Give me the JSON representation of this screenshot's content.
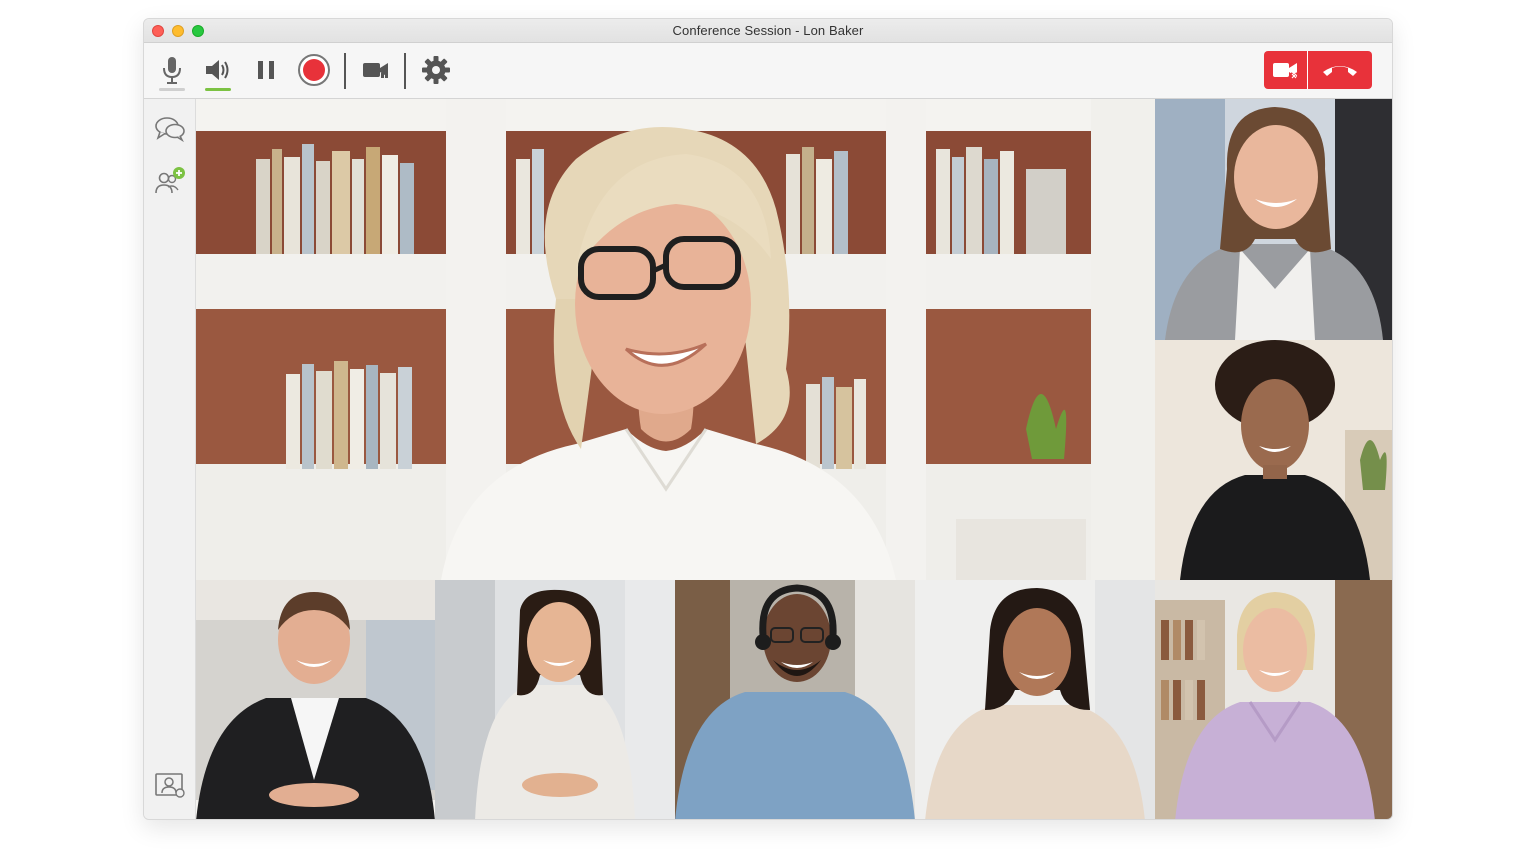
{
  "window": {
    "title": "Conference Session - Lon Baker"
  },
  "toolbar": {
    "items": [
      {
        "name": "microphone-button",
        "icon": "microphone-icon",
        "active": false
      },
      {
        "name": "speaker-button",
        "icon": "speaker-icon",
        "active": true
      },
      {
        "name": "pause-button",
        "icon": "pause-icon",
        "active": false
      },
      {
        "name": "record-button",
        "icon": "record-icon",
        "active": false
      },
      {
        "name": "video-button",
        "icon": "video-camera-icon",
        "active": false
      },
      {
        "name": "settings-button",
        "icon": "gear-icon",
        "active": false
      }
    ],
    "end_controls": [
      {
        "name": "stop-video-button",
        "icon": "video-off-icon"
      },
      {
        "name": "hang-up-button",
        "icon": "phone-hangup-icon"
      }
    ]
  },
  "sidebar": {
    "items": [
      {
        "name": "chat-button",
        "icon": "chat-bubbles-icon"
      },
      {
        "name": "participants-button",
        "icon": "add-participants-icon"
      },
      {
        "name": "self-view-button",
        "icon": "contact-card-icon"
      }
    ]
  },
  "participants": [
    {
      "tile": "main-speaker-tile"
    },
    {
      "tile": "participant-tile-1"
    },
    {
      "tile": "participant-tile-2"
    },
    {
      "tile": "participant-tile-3"
    },
    {
      "tile": "participant-tile-4"
    },
    {
      "tile": "participant-tile-5"
    },
    {
      "tile": "participant-tile-6"
    },
    {
      "tile": "participant-tile-7"
    }
  ],
  "colors": {
    "accent": "#7cc243",
    "record": "#e8323a",
    "end_call": "#e8323a",
    "icon": "#555555"
  }
}
